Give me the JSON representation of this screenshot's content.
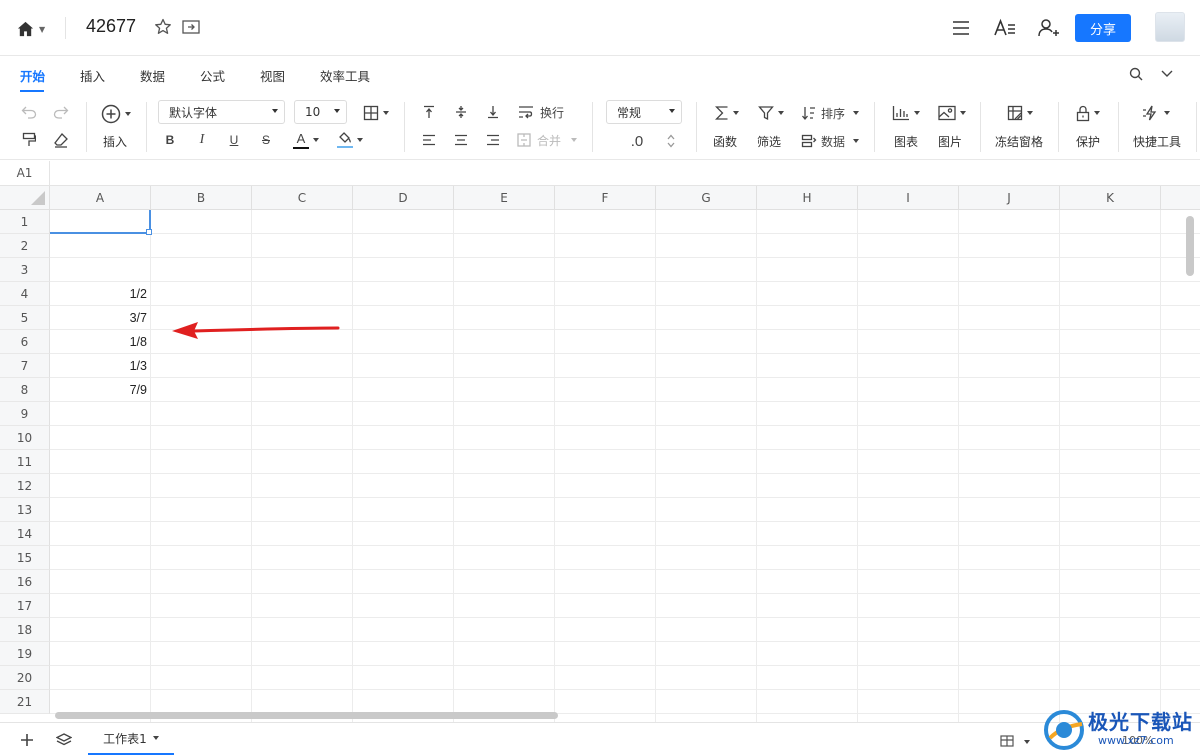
{
  "header": {
    "title": "42677",
    "share_label": "分享"
  },
  "tabs": [
    "开始",
    "插入",
    "数据",
    "公式",
    "视图",
    "效率工具"
  ],
  "toolbar": {
    "insert_label": "插入",
    "font_name": "默认字体",
    "font_size": "10",
    "wrap_label": "换行",
    "merge_label": "合并",
    "number_format": "常规",
    "decimal_label": ".0",
    "function_label": "函数",
    "filter_label": "筛选",
    "sort_label": "排序",
    "data_label": "数据",
    "chart_label": "图表",
    "image_label": "图片",
    "freeze_label": "冻结窗格",
    "protect_label": "保护",
    "quick_tools_label": "快捷工具",
    "bold": "B",
    "italic": "I",
    "underline": "U",
    "strike": "S",
    "font_color_glyph": "A"
  },
  "formula_bar": {
    "cell_ref": "A1"
  },
  "grid": {
    "columns": [
      "A",
      "B",
      "C",
      "D",
      "E",
      "F",
      "G",
      "H",
      "I",
      "J",
      "K"
    ],
    "rows": [
      "1",
      "2",
      "3",
      "4",
      "5",
      "6",
      "7",
      "8",
      "9",
      "10",
      "11",
      "12",
      "13",
      "14",
      "15",
      "16",
      "17",
      "18",
      "19",
      "20",
      "21"
    ],
    "cells": {
      "A4": "1/2",
      "A5": "3/7",
      "A6": "1/8",
      "A7": "1/3",
      "A8": "7/9"
    },
    "selected_cell": "A1"
  },
  "annotation": {
    "arrow_color": "#e02020"
  },
  "footer": {
    "sheet_name": "工作表1",
    "zoom": "100%"
  },
  "watermark": {
    "text": "极光下载站",
    "url": "www.xz7.com"
  },
  "colors": {
    "accent": "#1677ff"
  }
}
